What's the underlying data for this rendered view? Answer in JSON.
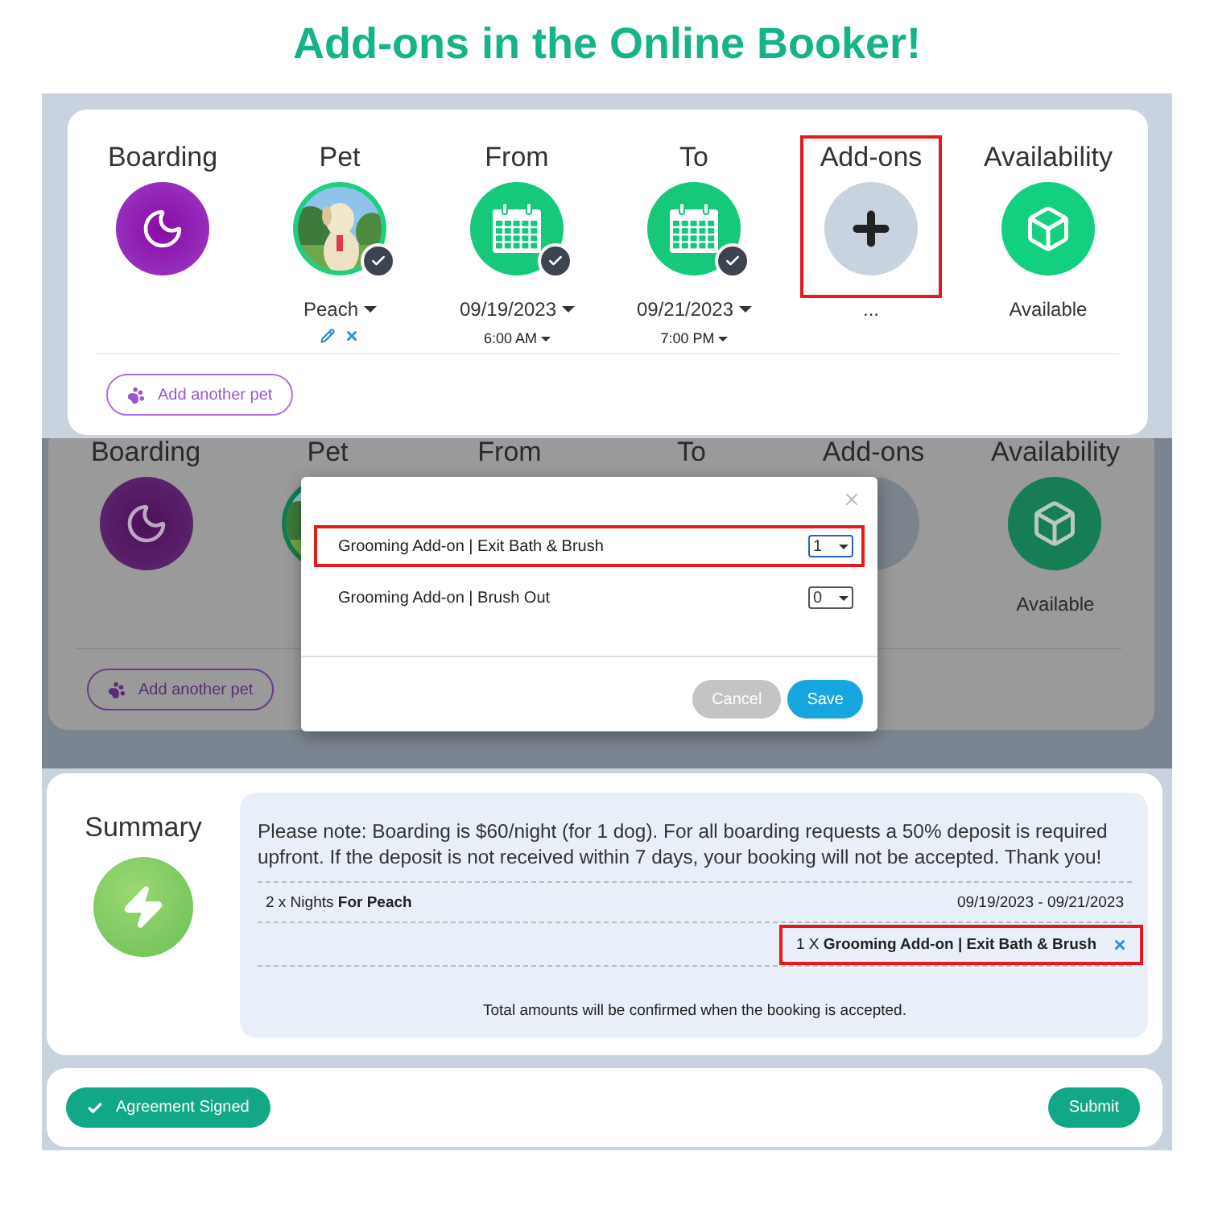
{
  "heading": "Add-ons in the Online Booker!",
  "booker": {
    "steps": [
      {
        "kind": "moon",
        "label": "Boarding",
        "highlighted": false
      },
      {
        "label": "Pet",
        "highlighted": false,
        "confirmed": true,
        "value": "Peach",
        "dropdown": true
      },
      {
        "kind": "calendar",
        "label": "From",
        "highlighted": false,
        "confirmed": true,
        "value": "09/19/2023",
        "dropdown": true,
        "time": "6:00 AM"
      },
      {
        "kind": "calendar",
        "label": "To",
        "highlighted": false,
        "confirmed": true,
        "value": "09/21/2023",
        "dropdown": true,
        "time": "7:00 PM"
      },
      {
        "kind": "plus",
        "label": "Add-ons",
        "highlighted": true,
        "value": "...",
        "dropdown": false
      },
      {
        "kind": "cube",
        "label": "Availability",
        "highlighted": false,
        "value": "Available",
        "dropdown": false
      }
    ],
    "add_pet_button": "Add another pet"
  },
  "dimmed_booker": {
    "steps": [
      {
        "kind": "moon",
        "label": "Boarding"
      },
      {
        "label": "Pet"
      },
      {
        "kind": "hidden",
        "label": "From"
      },
      {
        "kind": "hidden",
        "label": "To"
      },
      {
        "kind": "plus",
        "label": "Add-ons"
      },
      {
        "kind": "cube",
        "label": "Availability",
        "value": "Available",
        "dropdown": false
      }
    ],
    "add_pet_button": "Add another pet"
  },
  "modal": {
    "items": [
      {
        "name": "Grooming Add-on | Exit Bath & Brush",
        "quantity": "1",
        "highlighted": true,
        "focused": true
      },
      {
        "name": "Grooming Add-on | Brush Out",
        "quantity": "0",
        "highlighted": false,
        "focused": false
      }
    ],
    "cancel": "Cancel",
    "save": "Save"
  },
  "summary": {
    "title": "Summary",
    "note": "Please note: Boarding is $60/night (for 1 dog). For all boarding requests a 50% deposit is required upfront. If the deposit is not received within 7 days, your booking will not be accepted. Thank you!",
    "lines": [
      {
        "kind": "stay",
        "text": "2 x Nights **For Peach**",
        "dates": "09/19/2023 - 09/21/2023"
      },
      {
        "kind": "addon",
        "text": "1 X **Grooming Add-on | Exit Bath & Brush**",
        "highlighted": true
      }
    ],
    "total_note": "Total amounts will be confirmed when the booking is accepted."
  },
  "footer": {
    "agreement": "Agreement Signed",
    "submit": "Submit"
  }
}
